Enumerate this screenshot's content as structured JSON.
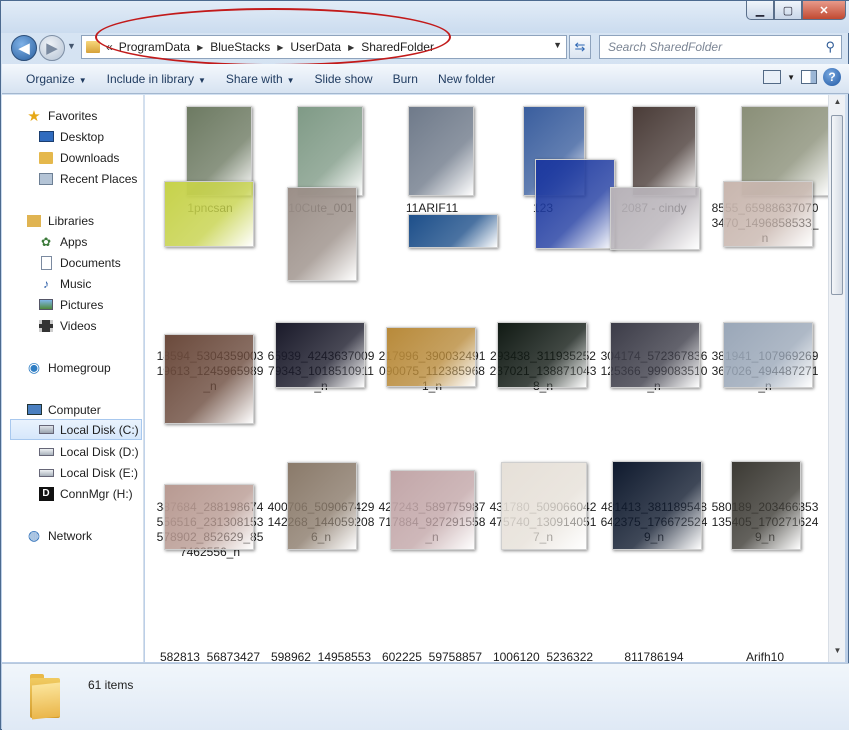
{
  "window": {
    "minimize": "▁",
    "maximize": "▢",
    "close": "✕"
  },
  "address": {
    "lead": "«",
    "crumbs": [
      "ProgramData",
      "BlueStacks",
      "UserData",
      "SharedFolder"
    ],
    "separator": "▶"
  },
  "search": {
    "placeholder": "Search SharedFolder"
  },
  "toolbar": {
    "organize": "Organize",
    "include_in_library": "Include in library",
    "share_with": "Share with",
    "slide_show": "Slide show",
    "burn": "Burn",
    "new_folder": "New folder",
    "help": "?"
  },
  "sidebar": {
    "favorites": "Favorites",
    "desktop": "Desktop",
    "downloads": "Downloads",
    "recent_places": "Recent Places",
    "libraries": "Libraries",
    "apps": "Apps",
    "documents": "Documents",
    "music": "Music",
    "pictures": "Pictures",
    "videos": "Videos",
    "homegroup": "Homegroup",
    "computer": "Computer",
    "local_c": "Local Disk (C:)",
    "local_d": "Local Disk (D:)",
    "local_e": "Local Disk (E:)",
    "connmgr": "ConnMgr (H:)",
    "network": "Network"
  },
  "files": [
    {
      "name": "1pncsan",
      "color": "#6d7a62"
    },
    {
      "name": "10Cute_001",
      "color": "#7f9a86"
    },
    {
      "name": "11ARIF11",
      "color": "#6f7a8a"
    },
    {
      "name": "123",
      "color": "#3a5e9e"
    },
    {
      "name": "2087 - cindy",
      "color": "#4a3c38"
    },
    {
      "name": "8555_659886370703470_1496858533_n",
      "color": "#8a8f78"
    },
    {
      "name": "18594_530435900319613_1245965989_n",
      "color": "#c6d24a"
    },
    {
      "name": "65939_424363700979343_1018510911_n",
      "color": "#9b8f88"
    },
    {
      "name": "217996_390032491090075_1123859681_n",
      "color": "#1d4f8a"
    },
    {
      "name": "293438_311935252237021_1388710438_n",
      "color": "#1e3aa0"
    },
    {
      "name": "304174_572367836125366_999083510_n",
      "color": "#b7b2b8"
    },
    {
      "name": "381941_107969269367026_494487271_n",
      "color": "#c8b6ae"
    },
    {
      "name": "387684_288198674556516_231308153578902_852629_857462556_n",
      "color": "#6b4a3c"
    },
    {
      "name": "400706_509067429142268_1440592086_n",
      "color": "#1a1a2a"
    },
    {
      "name": "427243_589775987717884_927291558_n",
      "color": "#b88a3a"
    },
    {
      "name": "431780_509066042475740_1309140517_n",
      "color": "#111a14"
    },
    {
      "name": "481413_381189548642375_1766725249_n",
      "color": "#3c3c48"
    },
    {
      "name": "580189_203466353135405_1702716249_n",
      "color": "#9aa7b8"
    },
    {
      "name": "582813_56873427",
      "color": "#b89a92"
    },
    {
      "name": "598962_14958553",
      "color": "#8a7a6a"
    },
    {
      "name": "602225_59758857",
      "color": "#c2a6a8"
    },
    {
      "name": "1006120_5236322",
      "color": "#e6e0d8"
    },
    {
      "name": "811786194",
      "color": "#0f1a2e"
    },
    {
      "name": "Arifh10",
      "color": "#3c3a34"
    }
  ],
  "status": {
    "count": "61 items"
  }
}
